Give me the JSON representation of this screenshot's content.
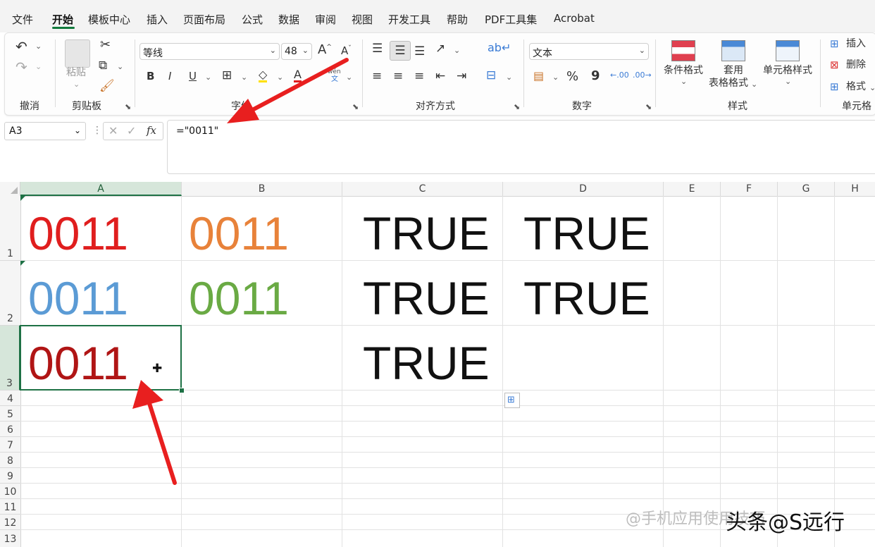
{
  "menu": {
    "items": [
      "文件",
      "开始",
      "模板中心",
      "插入",
      "页面布局",
      "公式",
      "数据",
      "审阅",
      "视图",
      "开发工具",
      "帮助",
      "PDF工具集",
      "Acrobat"
    ],
    "active": "开始"
  },
  "ribbon": {
    "undo_group": {
      "label": "撤消"
    },
    "clipboard": {
      "paste_label": "粘贴",
      "label": "剪贴板"
    },
    "font": {
      "name": "等线",
      "size": "48",
      "label": "字体",
      "phonetic": "wén"
    },
    "alignment": {
      "label": "对齐方式"
    },
    "number": {
      "format": "文本",
      "label": "数字",
      "percent": "%",
      "comma": "9",
      "inc_decimal": ".00",
      "dec_decimal": ".00"
    },
    "styles": {
      "conditional": "条件格式",
      "table_format_line1": "套用",
      "table_format_line2": "表格格式",
      "cell_styles": "单元格样式",
      "label": "样式"
    },
    "cells": {
      "insert": "插入",
      "delete": "删除",
      "format": "格式",
      "label": "单元格"
    }
  },
  "formula_bar": {
    "name_box": "A3",
    "fx": "fx",
    "formula": "=\"0011\""
  },
  "sheet": {
    "columns": [
      "A",
      "B",
      "C",
      "D",
      "E",
      "F",
      "G",
      "H"
    ],
    "selected_column": "A",
    "rows": [
      "1",
      "2",
      "3",
      "4",
      "5",
      "6",
      "7",
      "8",
      "9",
      "10",
      "11",
      "12",
      "13"
    ],
    "selected_row": "3",
    "cells": {
      "A1": "0011",
      "B1": "0011",
      "C1": "TRUE",
      "D1": "TRUE",
      "A2": "0011",
      "B2": "0011",
      "C2": "TRUE",
      "D2": "TRUE",
      "A3": "0011",
      "C3": "TRUE"
    },
    "colors": {
      "A1": "#e01e1e",
      "B1": "#e8823a",
      "A2": "#5b9bd5",
      "B2": "#6aaa44",
      "A3": "#b01515",
      "bool": "#111111"
    },
    "active_cell": "A3"
  },
  "watermark": {
    "text": "头条@S远行",
    "faint": "@手机应用使用技巧"
  }
}
